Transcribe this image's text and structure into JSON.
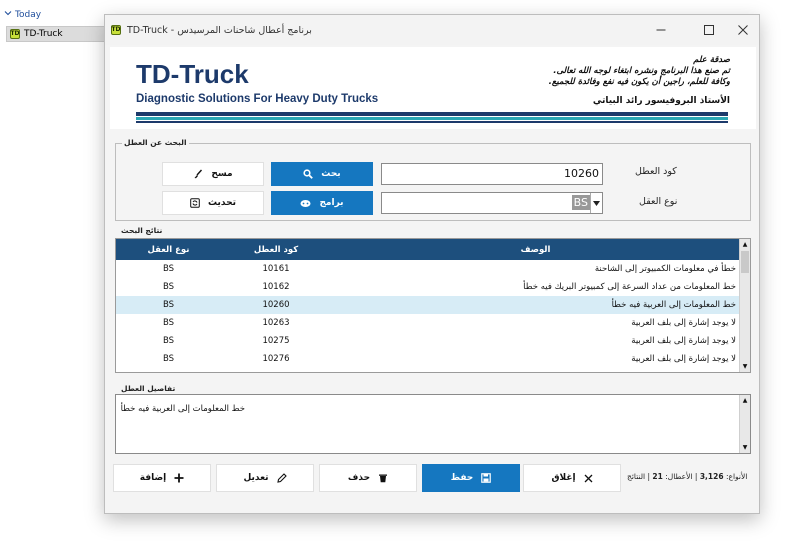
{
  "explorer": {
    "group_label": "Today",
    "item_label": "TD-Truck",
    "item_icon": "TD"
  },
  "window": {
    "title": "TD-Truck - برنامج أعطال شاحنات المرسيدس",
    "icon": "TD",
    "controls": {
      "minimize": "—",
      "maximize": "☐",
      "close": "✕"
    }
  },
  "banner": {
    "brand": "TD-Truck",
    "tagline": "Diagnostic Solutions For Heavy Duty Trucks",
    "dedication": [
      "صدقة علم",
      ".تم صنع هذا البرنامج ونشره ابتغاء لوجه الله تعالى",
      ".وكافة للعلم، راجين أن يكون فيه نفع وفائدة للجميع"
    ],
    "author": "الأستاذ البروفيسور   رائد البياتي"
  },
  "search": {
    "group_label": "البحث عن العطل",
    "code_label": "كود العطل",
    "code_value": "10260",
    "type_label": "نوع العقل",
    "type_value": "BS",
    "search_button": "بحث",
    "clear_button": "مسح",
    "programs_button": "برامج",
    "refresh_button": "تحديث"
  },
  "results": {
    "group_label": "نتائج البحث",
    "columns": {
      "type": "نوع العقل",
      "code": "كود العطل",
      "description": "الوصف"
    },
    "rows": [
      {
        "type": "BS",
        "code": "10161",
        "description": "خطأ في معلومات الكمبيوتر إلى الشاحنة"
      },
      {
        "type": "BS",
        "code": "10162",
        "description": "خط المعلومات من عداد السرعة إلى كمبيوتر البريك فيه خطأ"
      },
      {
        "type": "BS",
        "code": "10260",
        "description": "خط المعلومات إلى العربية فيه خطأ"
      },
      {
        "type": "BS",
        "code": "10263",
        "description": "لا يوجد إشارة إلى بلف العربية"
      },
      {
        "type": "BS",
        "code": "10275",
        "description": "لا يوجد إشارة إلى بلف العربية"
      },
      {
        "type": "BS",
        "code": "10276",
        "description": "لا يوجد إشارة إلى بلف العربية"
      }
    ],
    "selected_index": 2
  },
  "details": {
    "group_label": "تفاصيل العطل",
    "text": "خط المعلومات إلى العربية فيه خطأ"
  },
  "actions": {
    "close": "إغلاق",
    "save": "حفظ",
    "delete": "حذف",
    "edit": "تعديل",
    "add": "إضافة"
  },
  "status": {
    "results_label": "النتائج",
    "faults_label": "الأعطال:",
    "faults_value": "21",
    "types_label": "الأنواع:",
    "types_value": "3,126"
  },
  "colors": {
    "accent": "#1577c0",
    "grid_header": "#1d4f7d",
    "selected_row": "#d7ecf6",
    "brand": "#1d3a6b",
    "stripe_teal": "#2aa7b4"
  }
}
